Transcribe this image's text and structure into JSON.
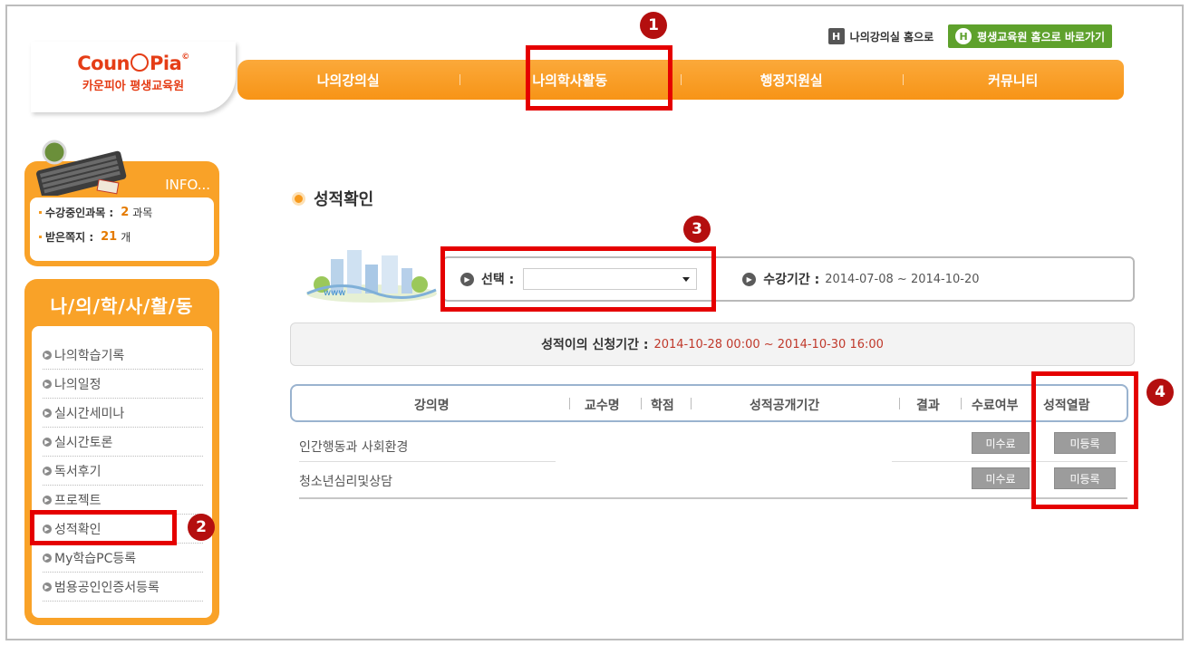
{
  "header": {
    "logo_en_left": "Coun",
    "logo_en_right": "Pia",
    "logo_reg": "©",
    "logo_kr": "카운피아 평생교육원",
    "toplink_home_icon": "H",
    "toplink_home": "나의강의실 홈으로",
    "toplink_main_icon": "H",
    "toplink_main": "평생교육원 홈으로 바로가기",
    "nav": [
      "나의강의실",
      "나의학사활동",
      "행정지원실",
      "커뮤니티"
    ]
  },
  "badges": [
    "1",
    "2",
    "3",
    "4"
  ],
  "sidebar": {
    "info_title": "INFO...",
    "info_rows": [
      {
        "label": "수강중인과목 :",
        "value": "2",
        "unit": "과목"
      },
      {
        "label": "받은쪽지 :",
        "value": "21",
        "unit": "개"
      }
    ],
    "menu_title": "나/의/학/사/활/동",
    "menu_items": [
      "나의학습기록",
      "나의일정",
      "실시간세미나",
      "실시간토론",
      "독서후기",
      "프로젝트",
      "성적확인",
      "My학습PC등록",
      "범용공인인증서등록"
    ]
  },
  "main": {
    "title": "성적확인",
    "select_label": "선택 :",
    "select_value": "",
    "period_label": "수강기간 :",
    "period_value": "2014-07-08 ~ 2014-10-20",
    "appeal_label": "성적이의 신청기간 :",
    "appeal_value": "2014-10-28 00:00 ~ 2014-10-30 16:00",
    "columns": [
      "강의명",
      "교수명",
      "학점",
      "성적공개기간",
      "결과",
      "수료여부",
      "성적열람"
    ],
    "rows": [
      {
        "course": "인간행동과 사회환경",
        "status": "미수료",
        "view": "미등록"
      },
      {
        "course": "청소년심리및상담",
        "status": "미수료",
        "view": "미등록"
      }
    ]
  },
  "colors": {
    "accent": "#f79417",
    "annotation": "#e50000",
    "badge": "#b40f0f",
    "link_green": "#5ea12c"
  }
}
